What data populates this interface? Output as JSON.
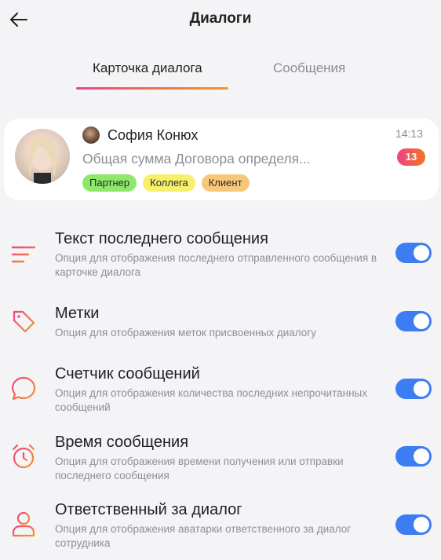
{
  "header": {
    "title": "Диалоги",
    "back_icon": "arrow-left-icon"
  },
  "tabs": [
    {
      "label": "Карточка диалога",
      "active": true
    },
    {
      "label": "Сообщения",
      "active": false
    }
  ],
  "dialog_card": {
    "contact_name": "София Конюх",
    "message_preview": "Общая сумма Договора определя...",
    "time": "14:13",
    "unread_count": "13",
    "tags": [
      {
        "label": "Партнер",
        "color": "#8ee86a"
      },
      {
        "label": "Коллега",
        "color": "#f6f06a"
      },
      {
        "label": "Клиент",
        "color": "#f8c87a"
      }
    ]
  },
  "settings": [
    {
      "icon": "lines-icon",
      "title": "Текст последнего сообщения",
      "description": "Опция для отображения последнего отправленного сообщения в карточке диалога",
      "enabled": true
    },
    {
      "icon": "tag-icon",
      "title": "Метки",
      "description": "Опция для отображения меток присвоенных диалогу",
      "enabled": true
    },
    {
      "icon": "chat-bubble-icon",
      "title": "Счетчик сообщений",
      "description": "Опция для отображения количества последних непрочитанных сообщений",
      "enabled": true
    },
    {
      "icon": "alarm-clock-icon",
      "title": "Время сообщения",
      "description": "Опция для отображения времени получения или отправки последнего сообщения",
      "enabled": true
    },
    {
      "icon": "user-icon",
      "title": "Ответственный за диалог",
      "description": "Опция для отображения аватарки ответственного за диалог сотрудника",
      "enabled": true
    }
  ],
  "colors": {
    "accent_gradient_start": "#f0418a",
    "accent_gradient_end": "#f29a1f",
    "toggle_on": "#3d7df2",
    "background": "#f4f4f6"
  }
}
